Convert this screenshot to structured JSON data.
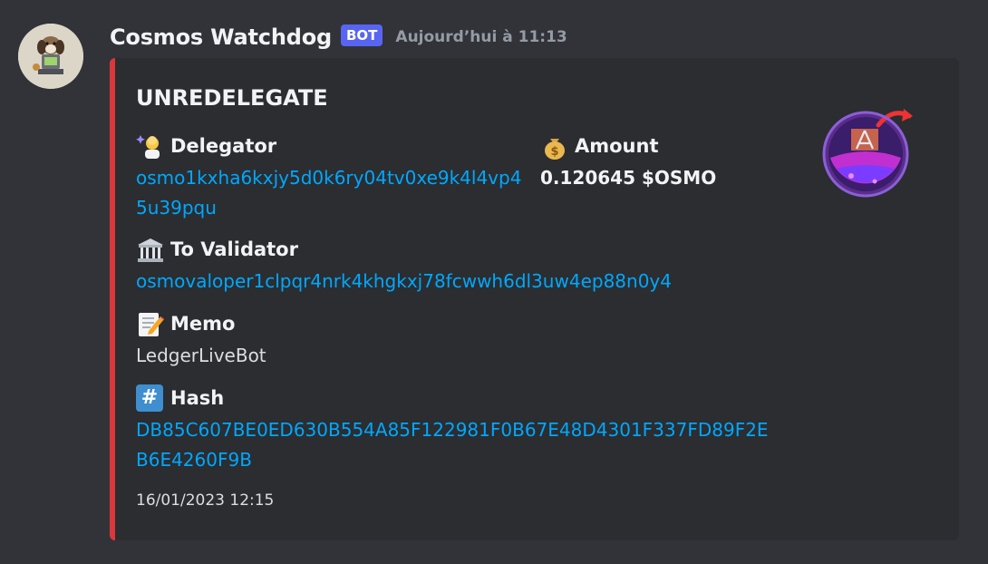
{
  "message": {
    "username": "Cosmos Watchdog",
    "bot_tag": "BOT",
    "timestamp": "Aujourd’hui à 11:13",
    "avatar_icon": "dog-robot-avatar"
  },
  "embed": {
    "accent_color": "#da373c",
    "title": "UNREDELEGATE",
    "thumbnail_icon": "osmosis-potion-icon",
    "fields": {
      "delegator": {
        "name": "Delegator",
        "icon": "person-sparkles-emoji",
        "value": "osmo1kxha6kxjy5d0k6ry04tv0xe9k4l4vp45u39pqu"
      },
      "amount": {
        "name": "Amount",
        "icon": "money-bag-emoji",
        "value": "0.120645 $OSMO"
      },
      "validator": {
        "name": "To Validator",
        "icon": "classical-building-emoji",
        "value": "osmovaloper1clpqr4nrk4khgkxj78fcwwh6dl3uw4ep88n0y4"
      },
      "memo": {
        "name": "Memo",
        "icon": "memo-emoji",
        "value": "LedgerLiveBot"
      },
      "hash": {
        "name": "Hash",
        "icon": "hash-keycap-emoji",
        "symbol": "#",
        "value": "DB85C607BE0ED630B554A85F122981F0B67E48D4301F337FD89F2EB6E4260F9B"
      }
    },
    "footer": "16/01/2023 12:15"
  }
}
